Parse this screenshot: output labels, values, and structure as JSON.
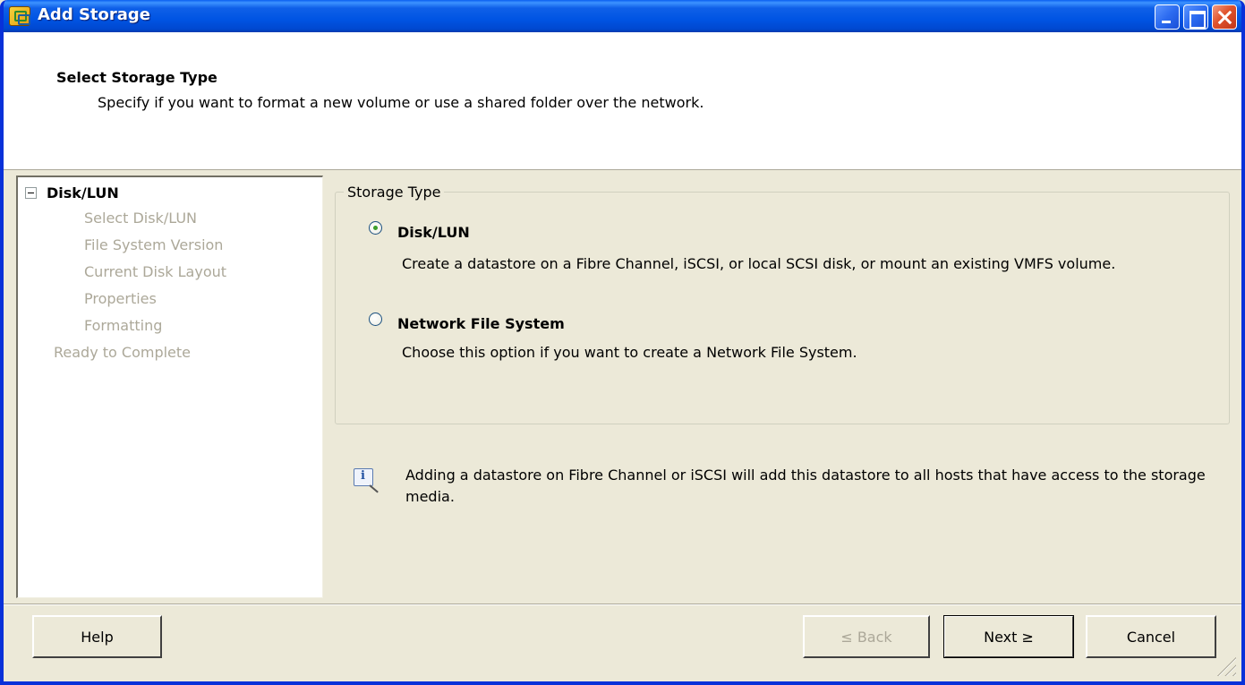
{
  "window": {
    "title": "Add Storage",
    "icon": "vsphere-storage-icon",
    "controls": [
      "minimize-icon",
      "maximize-icon",
      "close-icon"
    ]
  },
  "header": {
    "title": "Select Storage Type",
    "subtitle": "Specify if you want to format a new volume or use a shared folder over the network."
  },
  "nav": {
    "root_label": "Disk/LUN",
    "sub_items": [
      "Select Disk/LUN",
      "File System Version",
      "Current Disk Layout",
      "Properties",
      "Formatting"
    ],
    "last_item": "Ready to Complete"
  },
  "storage_type": {
    "legend": "Storage Type",
    "options": [
      {
        "label": "Disk/LUN",
        "description": "Create a datastore on a Fibre Channel, iSCSI, or local SCSI disk, or mount an existing VMFS volume.",
        "selected": true
      },
      {
        "label": "Network File System",
        "description": "Choose this option if you want to create a Network File System.",
        "selected": false
      }
    ]
  },
  "info": {
    "text": "Adding a datastore on Fibre Channel or iSCSI will add this datastore to all hosts that have access to the storage media."
  },
  "buttons": {
    "help": "Help",
    "back": "≤ Back",
    "next": "Next ≥",
    "cancel": "Cancel"
  },
  "colors": {
    "titlebar": "#0054E3",
    "dialog_bg": "#ECE9D8",
    "disabled_text": "#ACA899"
  }
}
